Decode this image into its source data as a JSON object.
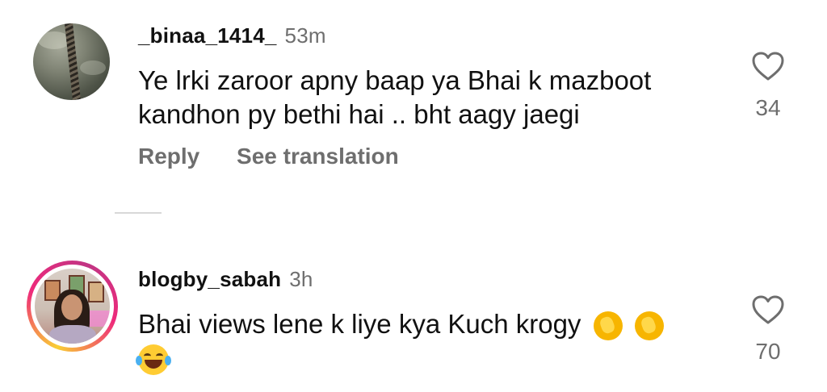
{
  "comments": [
    {
      "username": "_binaa_1414_",
      "time": "53m",
      "text_line1": "Ye lrki zaroor apny baap ya Bhai k mazboot",
      "text_line2": "kandhon py bethi hai .. bht aagy jaegi",
      "reply_label": "Reply",
      "translate_label": "See translation",
      "likes": "34",
      "avatar_icon": "hanging-rope-cloudy-sky-avatar"
    },
    {
      "username": "blogby_sabah",
      "time": "3h",
      "text": "Bhai views lene k liye kya Kuch krogy",
      "emojis": [
        "clapping-hands-emoji",
        "clapping-hands-emoji",
        "face-with-tears-of-joy-emoji"
      ],
      "likes": "70",
      "has_story_ring": true,
      "avatar_icon": "woman-portrait-avatar"
    }
  ],
  "colors": {
    "primary_text": "#111111",
    "secondary_text": "#6e6e6e",
    "story_ring_start": "#f9ce34",
    "story_ring_end": "#ee2a7b",
    "divider": "#d8d8d8"
  }
}
